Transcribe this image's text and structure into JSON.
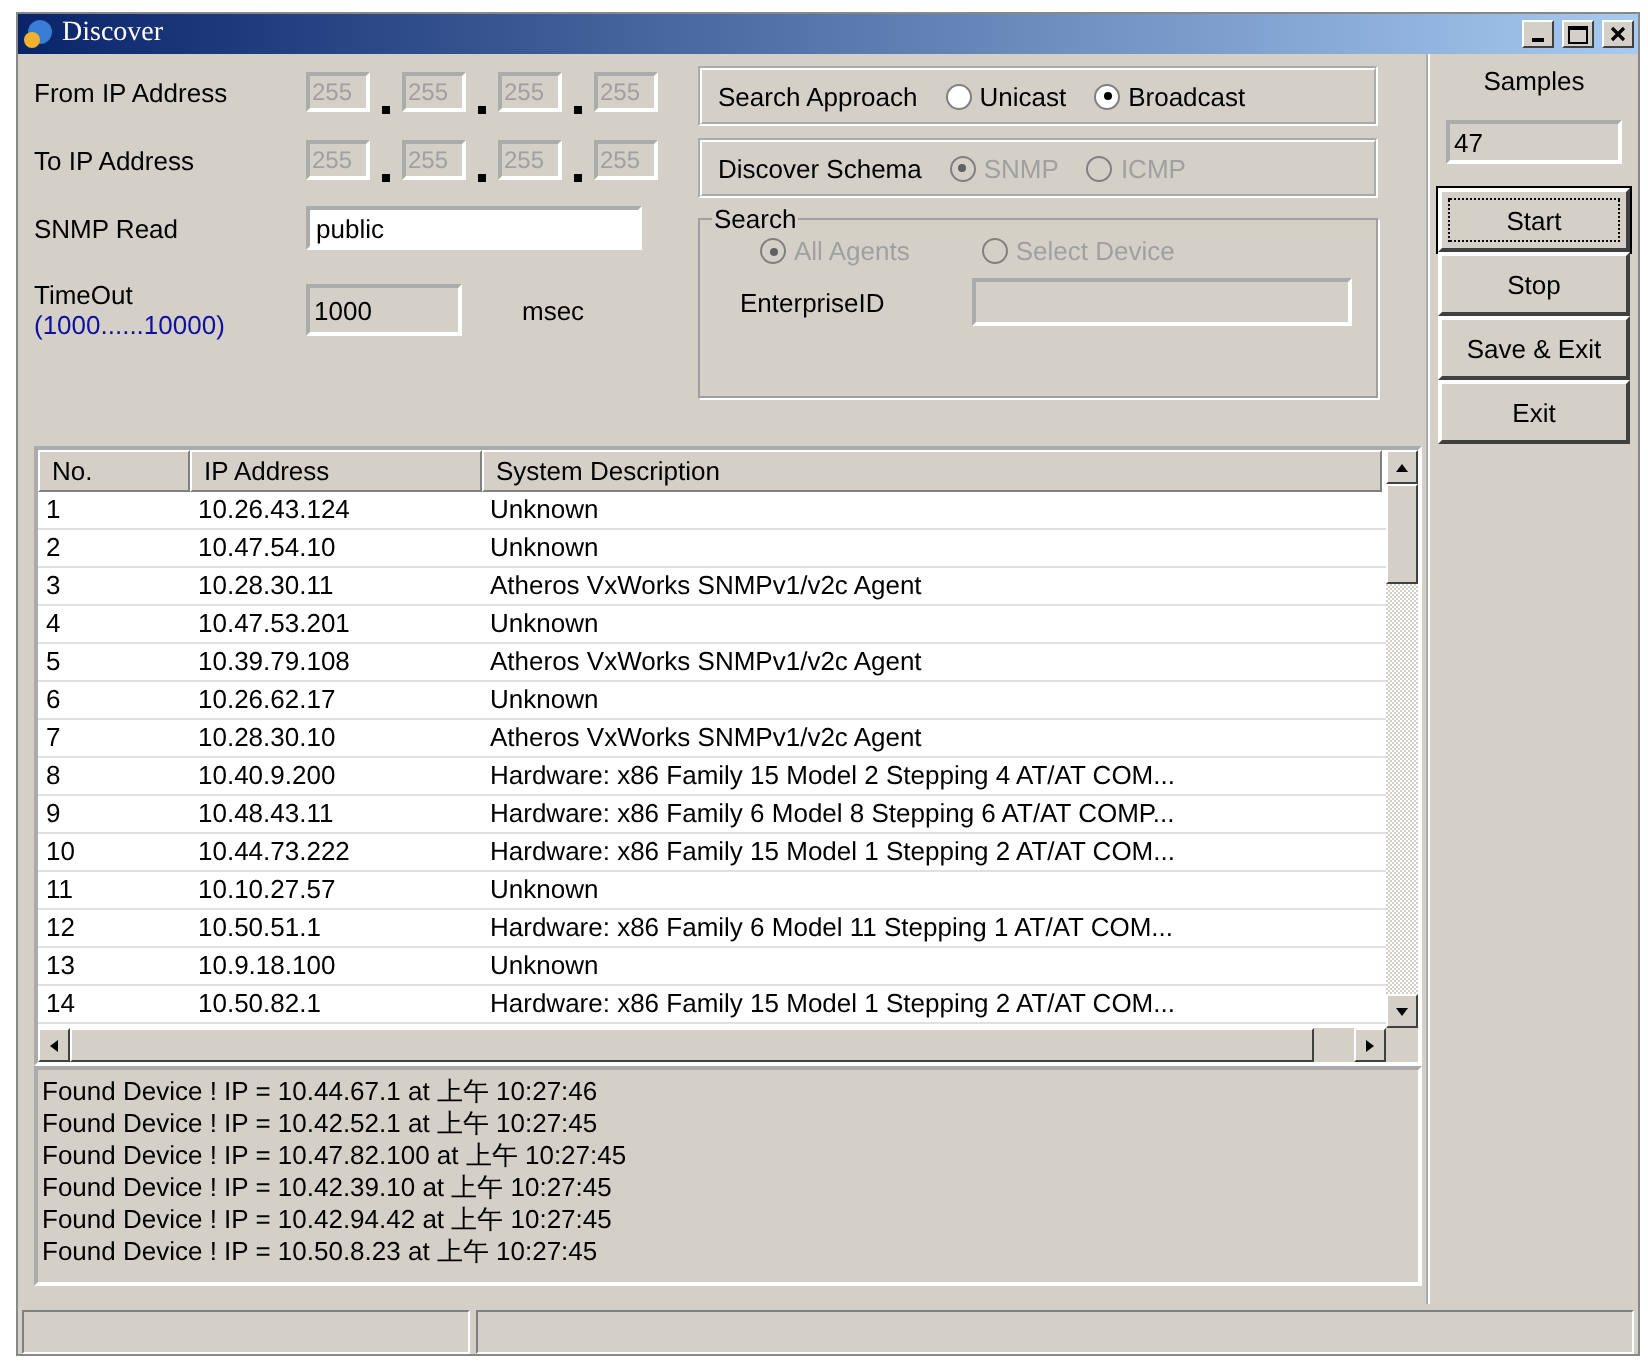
{
  "window": {
    "title": "Discover"
  },
  "from_ip": {
    "label": "From IP Address",
    "disabled": true,
    "octets": [
      "255",
      "255",
      "255",
      "255"
    ]
  },
  "to_ip": {
    "label": "To IP Address",
    "disabled": true,
    "octets": [
      "255",
      "255",
      "255",
      "255"
    ]
  },
  "snmp_read": {
    "label": "SNMP Read",
    "value": "public"
  },
  "timeout": {
    "label": "TimeOut",
    "range": "(1000......10000)",
    "value": "1000",
    "unit": "msec"
  },
  "search_approach": {
    "label": "Search Approach",
    "disabled": false,
    "options": [
      {
        "label": "Unicast",
        "selected": false
      },
      {
        "label": "Broadcast",
        "selected": true
      }
    ]
  },
  "discover_schema": {
    "label": "Discover Schema",
    "disabled": true,
    "options": [
      {
        "label": "SNMP",
        "selected": true
      },
      {
        "label": "ICMP",
        "selected": false
      }
    ]
  },
  "search": {
    "title": "Search",
    "disabled": true,
    "options": [
      {
        "label": "All Agents",
        "selected": true
      },
      {
        "label": "Select Device",
        "selected": false
      }
    ],
    "enterprise_label": "EnterpriseID"
  },
  "samples": {
    "label": "Samples",
    "value": "47"
  },
  "buttons": [
    {
      "label": "Start",
      "focused": true
    },
    {
      "label": "Stop",
      "focused": false
    },
    {
      "label": "Save & Exit",
      "focused": false
    },
    {
      "label": "Exit",
      "focused": false
    }
  ],
  "table": {
    "columns": [
      "No.",
      "IP Address",
      "System Description"
    ],
    "rows": [
      [
        "1",
        "10.26.43.124",
        "Unknown"
      ],
      [
        "2",
        "10.47.54.10",
        "Unknown"
      ],
      [
        "3",
        "10.28.30.11",
        "Atheros VxWorks SNMPv1/v2c Agent"
      ],
      [
        "4",
        "10.47.53.201",
        "Unknown"
      ],
      [
        "5",
        "10.39.79.108",
        "Atheros VxWorks SNMPv1/v2c Agent"
      ],
      [
        "6",
        "10.26.62.17",
        "Unknown"
      ],
      [
        "7",
        "10.28.30.10",
        "Atheros VxWorks SNMPv1/v2c Agent"
      ],
      [
        "8",
        "10.40.9.200",
        "Hardware: x86 Family 15 Model 2 Stepping 4 AT/AT COM..."
      ],
      [
        "9",
        "10.48.43.11",
        "Hardware: x86 Family 6 Model 8 Stepping 6 AT/AT COMP..."
      ],
      [
        "10",
        "10.44.73.222",
        "Hardware: x86 Family 15 Model 1 Stepping 2 AT/AT COM..."
      ],
      [
        "11",
        "10.10.27.57",
        "Unknown"
      ],
      [
        "12",
        "10.50.51.1",
        "Hardware: x86 Family 6 Model 11 Stepping 1 AT/AT COM..."
      ],
      [
        "13",
        "10.9.18.100",
        "Unknown"
      ],
      [
        "14",
        "10.50.82.1",
        "Hardware: x86 Family 15 Model 1 Stepping 2 AT/AT COM..."
      ]
    ]
  },
  "log": [
    "Found Device ! IP = 10.44.67.1 at 上午 10:27:46",
    "Found Device ! IP = 10.42.52.1 at 上午 10:27:45",
    "Found Device ! IP = 10.47.82.100 at 上午 10:27:45",
    "Found Device ! IP = 10.42.39.10 at 上午 10:27:45",
    "Found Device ! IP = 10.42.94.42 at 上午 10:27:45",
    "Found Device ! IP = 10.50.8.23 at 上午 10:27:45"
  ]
}
